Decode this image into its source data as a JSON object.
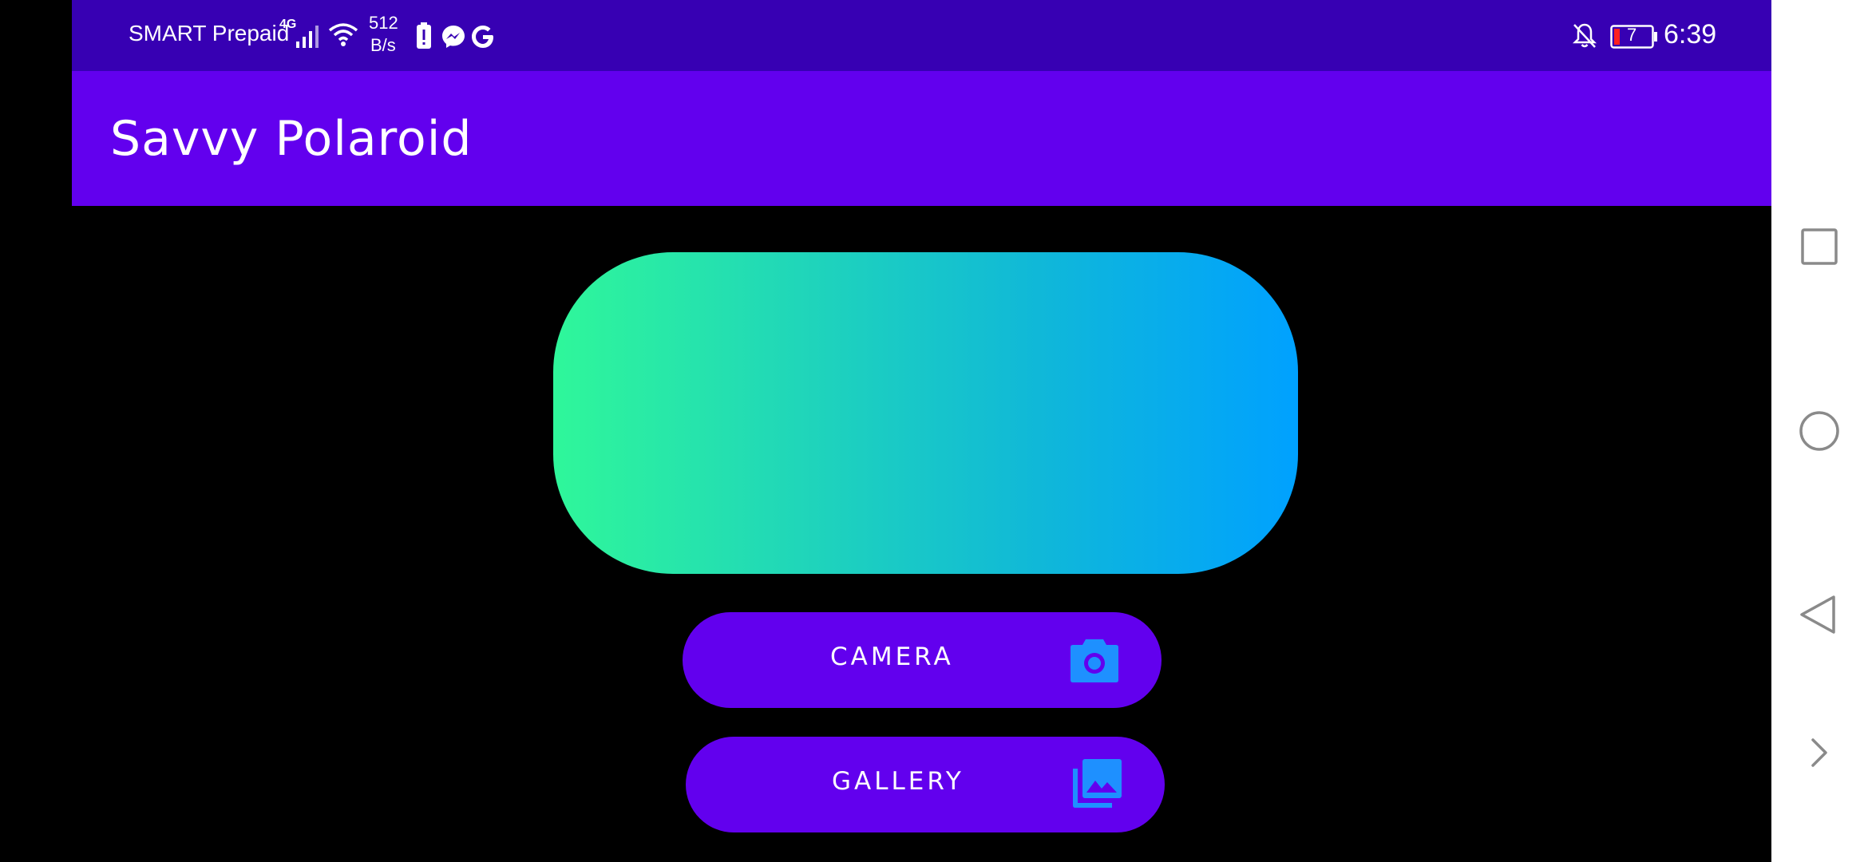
{
  "status_bar": {
    "carrier": "SMART Prepaid",
    "network_type": "4G",
    "net_speed_value": "512",
    "net_speed_unit": "B/s",
    "battery_level": "7",
    "time": "6:39",
    "icons": [
      "signal-icon",
      "wifi-icon",
      "battery-alert-icon",
      "messenger-icon",
      "google-icon",
      "notifications-off-icon",
      "battery-icon"
    ]
  },
  "app_bar": {
    "title": "Savvy Polaroid"
  },
  "preview": {
    "gradient_colors": [
      "#2ff79a",
      "#00a1ff"
    ]
  },
  "buttons": {
    "camera_label": "CAMERA",
    "camera_icon": "camera-icon",
    "gallery_label": "GALLERY",
    "gallery_icon": "photo-library-icon"
  },
  "nav_bar": {
    "items": [
      "recents-icon",
      "home-icon",
      "back-icon",
      "expand-icon"
    ]
  },
  "colors": {
    "status_bar": "#3700b3",
    "app_bar": "#6200ee",
    "button": "#6200ee",
    "icon_accent": "#1e90ff",
    "background": "#000000"
  }
}
